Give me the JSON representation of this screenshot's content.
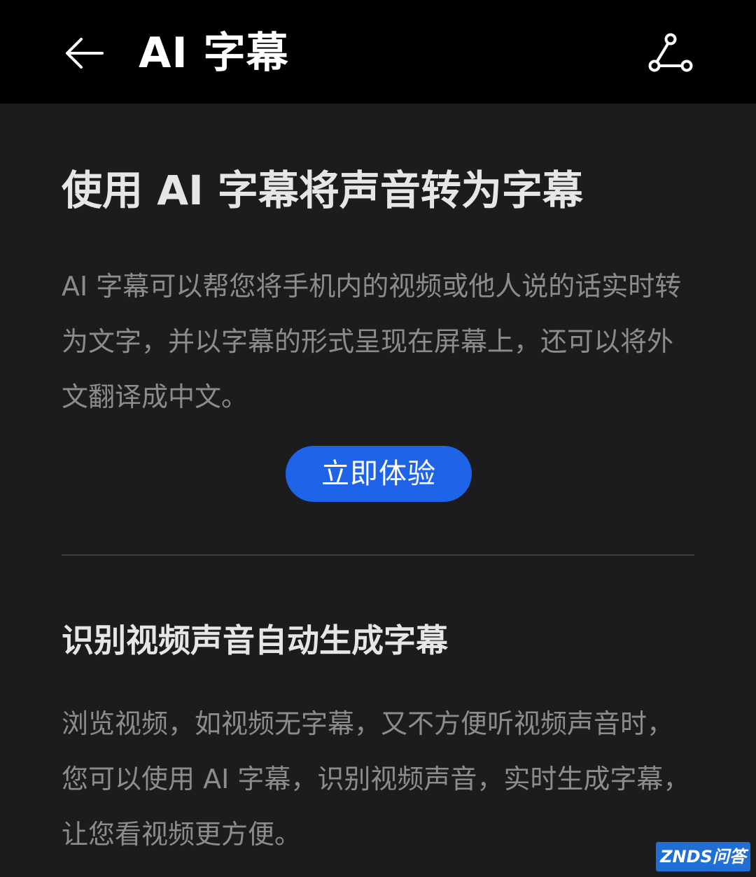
{
  "app_bar": {
    "title": "AI 字幕",
    "back_icon": "arrow-left-icon",
    "share_icon": "share-icon"
  },
  "intro": {
    "title": "使用 AI 字幕将声音转为字幕",
    "description": "AI 字幕可以帮您将手机内的视频或他人说的话实时转为文字，并以字幕的形式呈现在屏幕上，还可以将外文翻译成中文。",
    "button_label": "立即体验"
  },
  "feature": {
    "title": "识别视频声音自动生成字幕",
    "description": "浏览视频，如视频无字幕，又不方便听视频声音时，您可以使用 AI 字幕，识别视频声音，实时生成字幕，让您看视频更方便。"
  },
  "watermark": {
    "text": "ZNDS问答"
  },
  "colors": {
    "app_bar_bg": "#000000",
    "content_bg": "#1c1c1e",
    "accent_button": "#1f64e8",
    "title_text": "#e6e6e6",
    "body_text": "#8c8c8e"
  }
}
